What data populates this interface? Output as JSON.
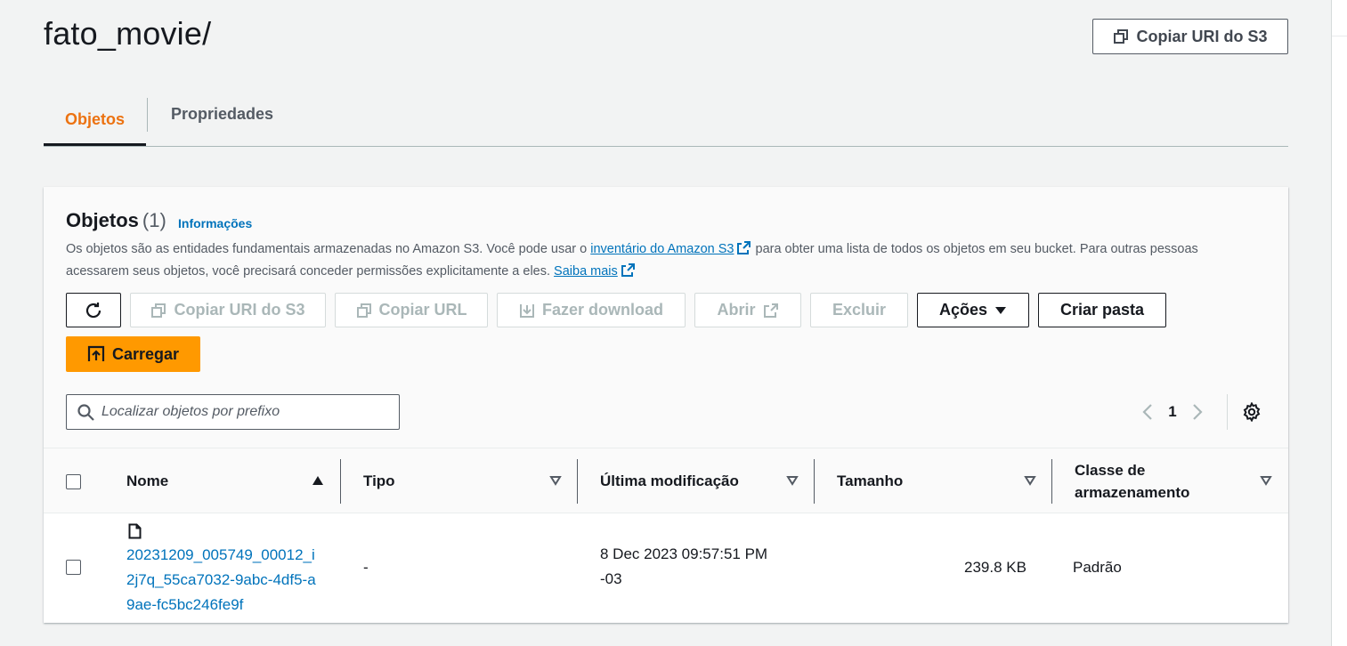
{
  "page": {
    "title": "fato_movie/",
    "copy_uri_label": "Copiar URI do S3"
  },
  "tabs": [
    {
      "label": "Objetos",
      "active": true
    },
    {
      "label": "Propriedades",
      "active": false
    }
  ],
  "objects_panel": {
    "title": "Objetos",
    "count": "(1)",
    "info_link": "Informações",
    "description_part1": "Os objetos são as entidades fundamentais armazenadas no Amazon S3. Você pode usar o",
    "inventory_link": "inventário do Amazon S3",
    "description_part2": "para obter uma lista de todos os objetos em seu bucket. Para outras pessoas acessarem seus objetos, você precisará conceder permissões explicitamente a eles.",
    "learn_more_link": "Saiba mais"
  },
  "toolbar": {
    "refresh_icon": "refresh-icon",
    "copy_uri": "Copiar URI do S3",
    "copy_url": "Copiar URL",
    "download": "Fazer download",
    "open": "Abrir",
    "delete": "Excluir",
    "actions": "Ações",
    "create_folder": "Criar pasta",
    "upload": "Carregar"
  },
  "search": {
    "placeholder": "Localizar objetos por prefixo",
    "value": ""
  },
  "pagination": {
    "current_page": "1"
  },
  "table": {
    "columns": [
      {
        "label": "Nome",
        "sort": "ascending"
      },
      {
        "label": "Tipo",
        "sort": "none"
      },
      {
        "label": "Última modificação",
        "sort": "none"
      },
      {
        "label": "Tamanho",
        "sort": "none"
      },
      {
        "label": "Classe de armazenamento",
        "sort": "none"
      }
    ],
    "rows": [
      {
        "name": "20231209_005749_00012_i2j7q_55ca7032-9abc-4df5-a9ae-fc5bc246fe9f",
        "type": "-",
        "last_modified": "8 Dec 2023 09:57:51 PM -03",
        "size": "239.8 KB",
        "storage_class": "Padrão"
      }
    ]
  },
  "colors": {
    "accent_orange": "#ec7211",
    "upload_orange": "#ff9900",
    "link_blue": "#0073bb",
    "text_dark": "#16191f",
    "text_muted": "#545b64",
    "disabled": "#aab7b8"
  }
}
